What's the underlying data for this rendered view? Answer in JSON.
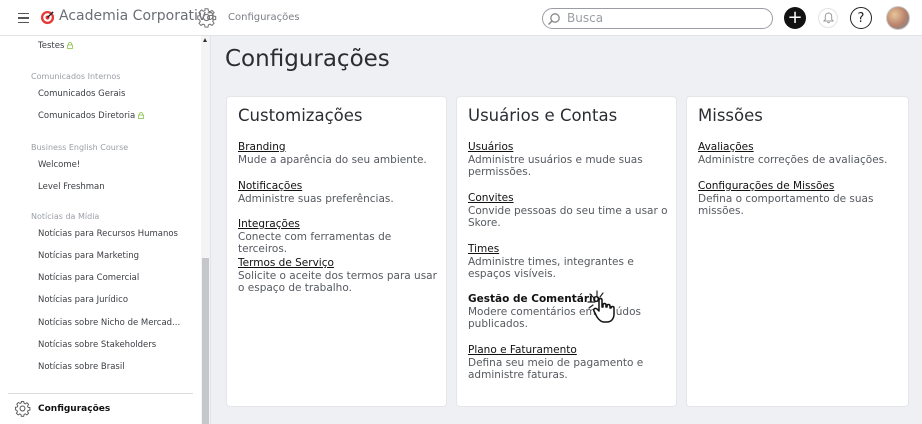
{
  "header": {
    "brand": "Academia Corporativa",
    "breadcrumb": "Configurações",
    "search_placeholder": "Busca",
    "help_label": "?",
    "plus_label": "+"
  },
  "sidebar": {
    "items_top": [
      {
        "label": "Testes",
        "locked": true
      }
    ],
    "groups": [
      {
        "name": "Comunicados Internos",
        "items": [
          {
            "label": "Comunicados Gerais",
            "locked": false
          },
          {
            "label": "Comunicados Diretoria",
            "locked": true
          }
        ]
      },
      {
        "name": "Business English Course",
        "items": [
          {
            "label": "Welcome!",
            "locked": false
          },
          {
            "label": "Level Freshman",
            "locked": false
          }
        ]
      },
      {
        "name": "Notícias da Mídia",
        "items": [
          {
            "label": "Notícias para Recursos Humanos",
            "locked": false
          },
          {
            "label": "Notícias para Marketing",
            "locked": false
          },
          {
            "label": "Notícias para Comercial",
            "locked": false
          },
          {
            "label": "Notícias para Jurídico",
            "locked": false
          },
          {
            "label": "Notícias sobre Nicho de Mercad...",
            "locked": false
          },
          {
            "label": "Notícias sobre Stakeholders",
            "locked": false
          },
          {
            "label": "Notícias sobre Brasil",
            "locked": false
          }
        ]
      }
    ],
    "config_label": "Configurações"
  },
  "main": {
    "title": "Configurações",
    "cards": [
      {
        "title": "Customizações",
        "entries": [
          {
            "link": "Branding",
            "desc": "Mude a aparência do seu ambiente."
          },
          {
            "link": "Notificações",
            "desc": "Administre suas preferências."
          },
          {
            "link": "Integrações",
            "desc": "Conecte com ferramentas de terceiros."
          },
          {
            "link": "Termos de Serviço",
            "desc": "Solicite o aceite dos termos para usar o espaço de trabalho."
          }
        ]
      },
      {
        "title": "Usuários e Contas",
        "entries": [
          {
            "link": "Usuários",
            "desc": "Administre usuários e mude suas permissões."
          },
          {
            "link": "Convites",
            "desc": "Convide pessoas do seu time a usar o Skore."
          },
          {
            "link": "Times",
            "desc": "Administre times, integrantes e espaços visíveis."
          },
          {
            "link": "Gestão de Comentário",
            "desc": "Modere comentários em      údos publicados."
          },
          {
            "link": "Plano e Faturamento",
            "desc": "Defina seu meio de pagamento e administre faturas."
          }
        ]
      },
      {
        "title": "Missões",
        "entries": [
          {
            "link": "Avaliações",
            "desc": "Administre correções de avaliações."
          },
          {
            "link": "Configurações de Missões",
            "desc": "Defina o comportamento de suas missões."
          }
        ]
      }
    ]
  }
}
